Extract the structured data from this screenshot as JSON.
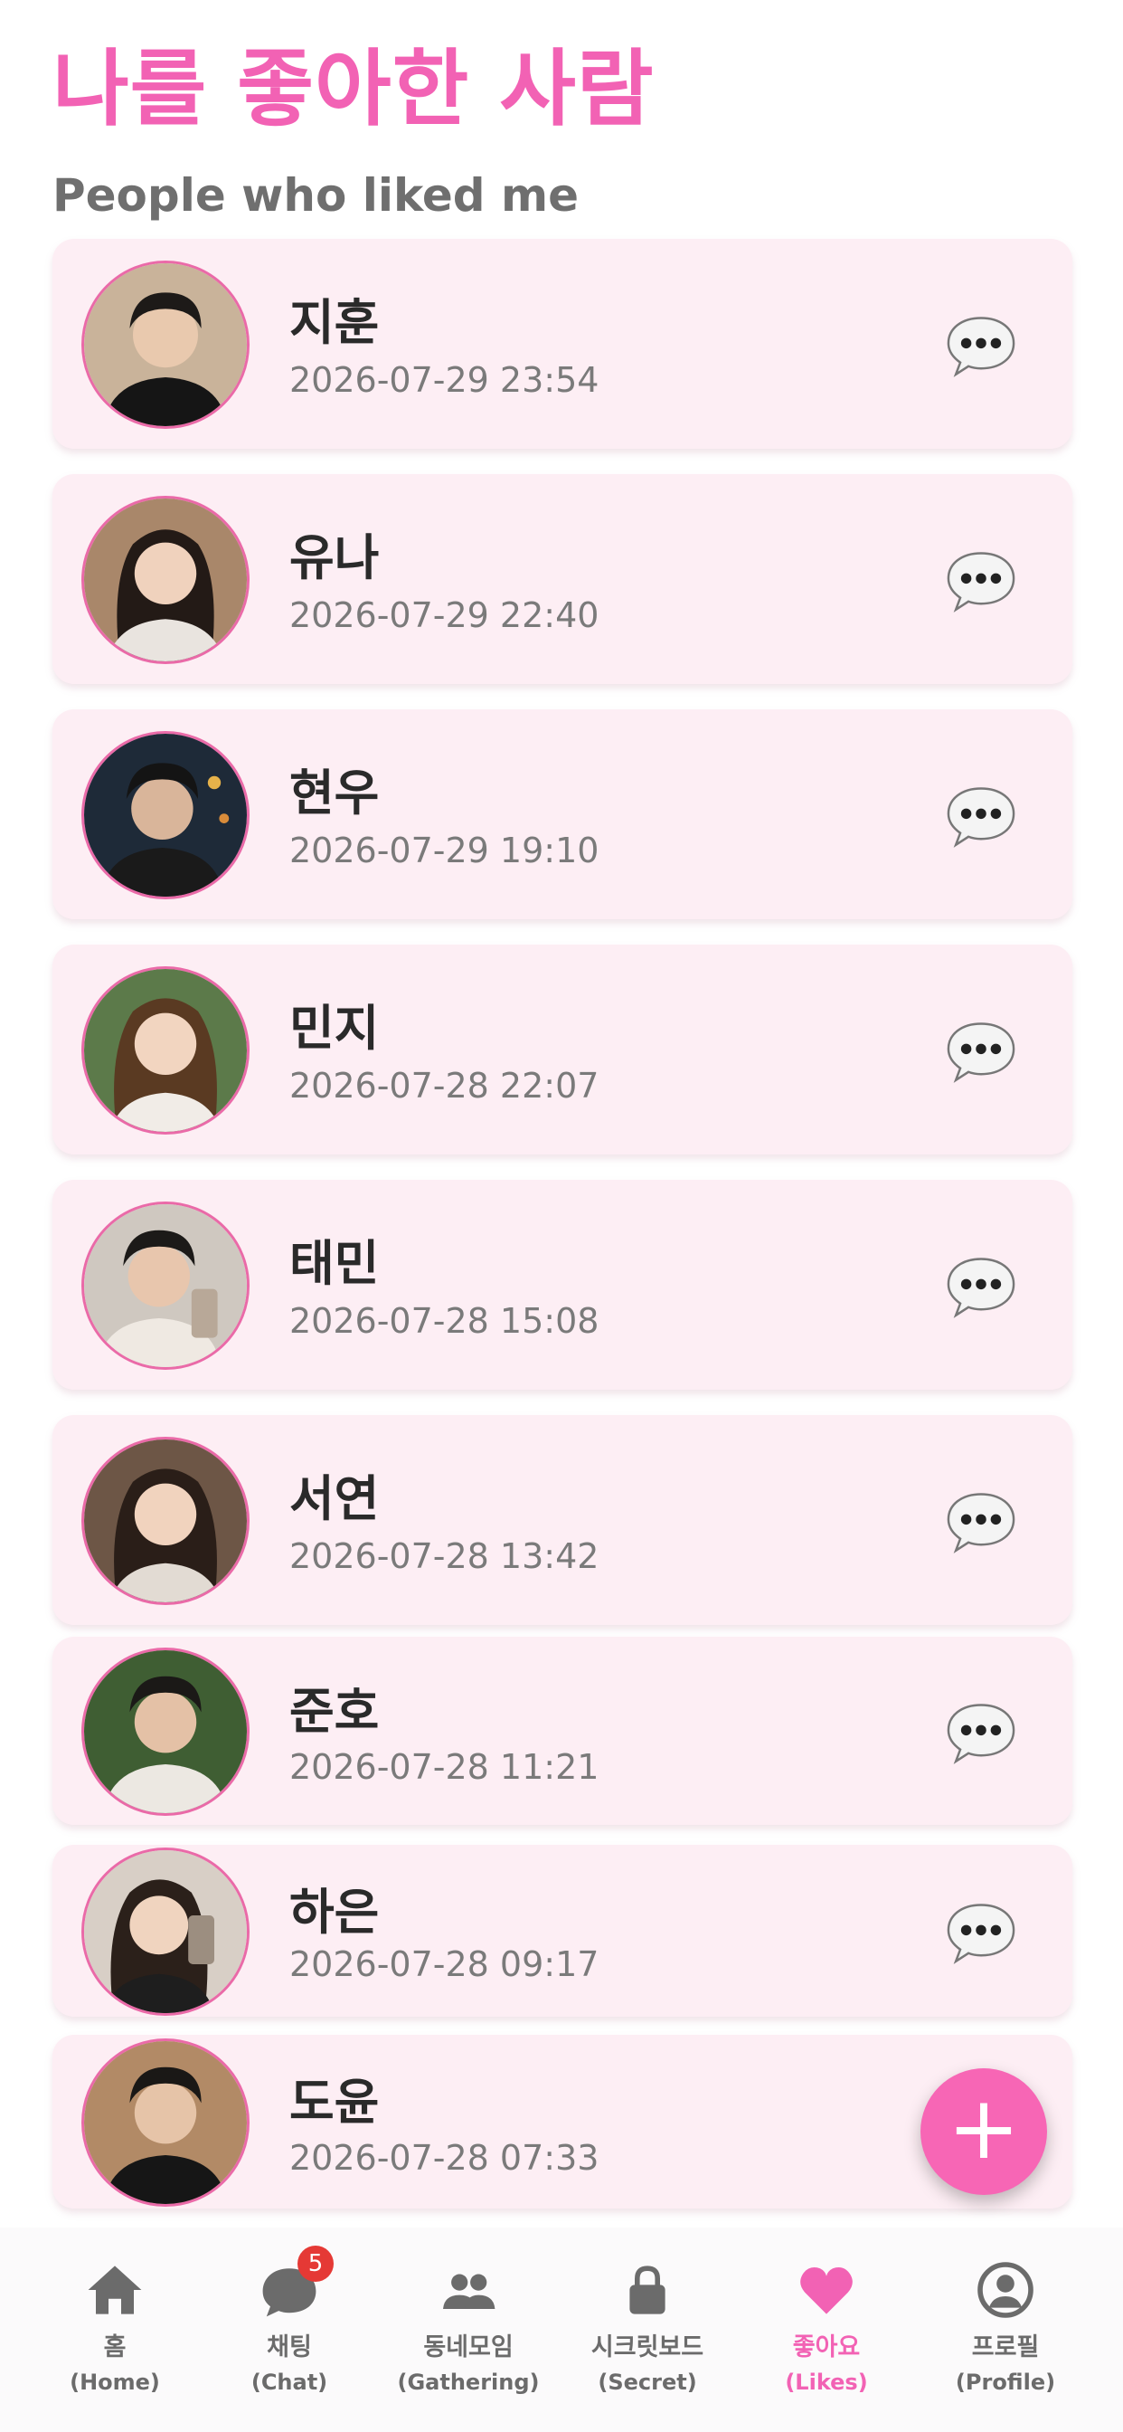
{
  "header": {
    "title": "나를 좋아한 사람",
    "subtitle": "People who liked me"
  },
  "likes": [
    {
      "name": "지훈",
      "time": "2026-07-29 23:54"
    },
    {
      "name": "유나",
      "time": "2026-07-29 22:40"
    },
    {
      "name": "현우",
      "time": "2026-07-29 19:10"
    },
    {
      "name": "민지",
      "time": "2026-07-28 22:07"
    },
    {
      "name": "태민",
      "time": "2026-07-28 15:08"
    },
    {
      "name": "서연",
      "time": "2026-07-28 13:42"
    },
    {
      "name": "준호",
      "time": "2026-07-28 11:21"
    },
    {
      "name": "하은",
      "time": "2026-07-28 09:17"
    },
    {
      "name": "도윤",
      "time": "2026-07-28 07:33"
    }
  ],
  "fab": {
    "symbol": "+"
  },
  "nav": {
    "items": [
      {
        "label": "홈",
        "sub": "(Home)",
        "icon": "home-icon"
      },
      {
        "label": "채팅",
        "sub": "(Chat)",
        "icon": "chat-icon",
        "badge": "5"
      },
      {
        "label": "동네모임",
        "sub": "(Gathering)",
        "icon": "people-icon"
      },
      {
        "label": "시크릿보드",
        "sub": "(Secret)",
        "icon": "lock-icon"
      },
      {
        "label": "좋아요",
        "sub": "(Likes)",
        "icon": "heart-icon",
        "active": true
      },
      {
        "label": "프로필",
        "sub": "(Profile)",
        "icon": "profile-icon"
      }
    ]
  },
  "colors": {
    "accent": "#f262b4",
    "card_bg": "#fdeef4",
    "badge": "#e53935"
  }
}
